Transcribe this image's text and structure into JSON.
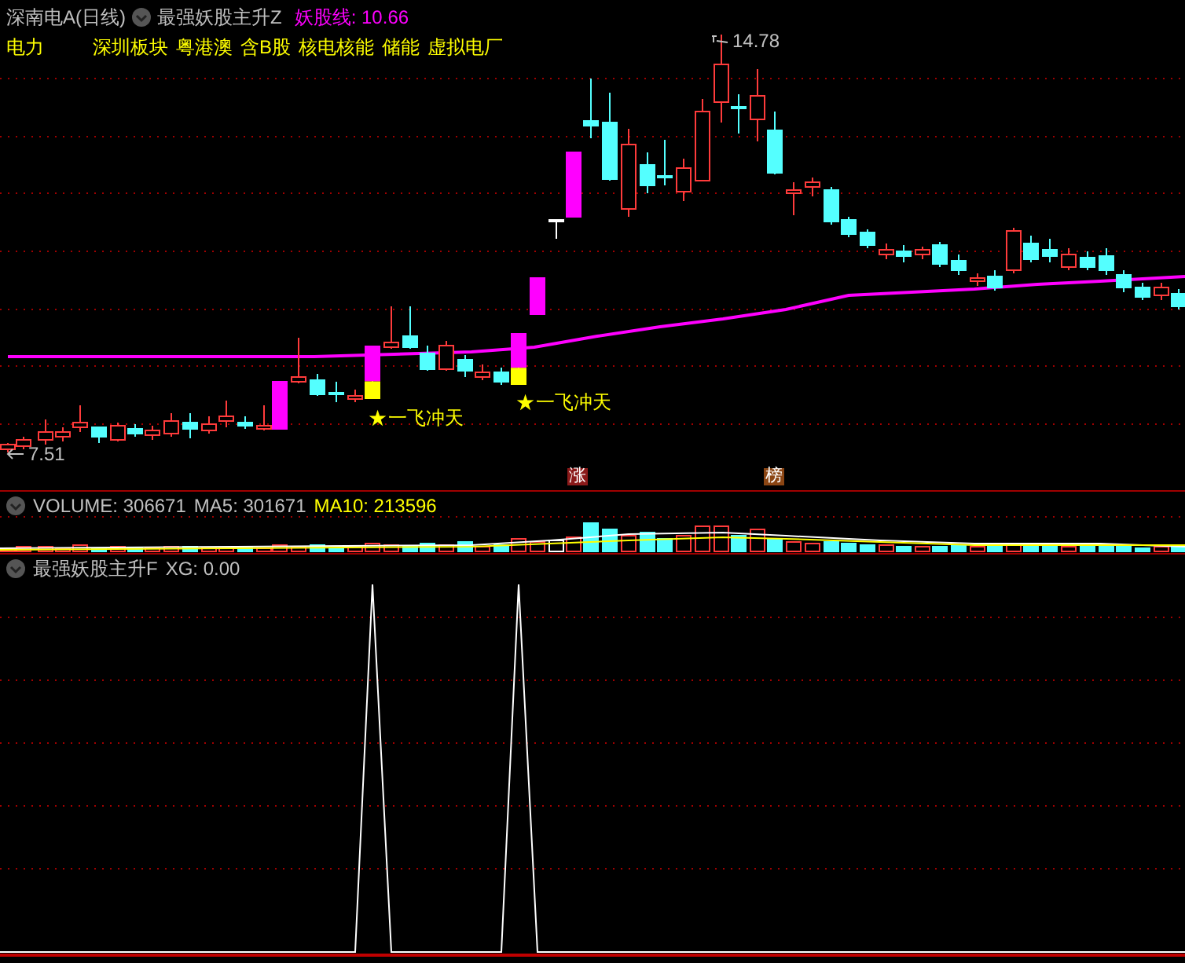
{
  "header": {
    "stock": "深南电A(日线)",
    "indicator": "最强妖股主升Z",
    "line_label": "妖股线: 10.66"
  },
  "tags": [
    "电力",
    "深圳板块",
    "粤港澳",
    "含B股",
    "核电核能",
    "储能",
    "虚拟电厂"
  ],
  "price_labels": {
    "high": "14.78",
    "low": "7.51"
  },
  "signals": [
    {
      "star": "★",
      "text": "一飞冲天"
    },
    {
      "star": "★",
      "text": "一飞冲天"
    }
  ],
  "badges": [
    {
      "text": "涨",
      "color": "#8b1a1a"
    },
    {
      "text": "榜",
      "color": "#8b4513"
    }
  ],
  "volume": {
    "volume": "VOLUME: 306671",
    "ma5": "MA5: 301671",
    "ma10": "MA10: 213596"
  },
  "sub_indicator": {
    "title": "最强妖股主升F",
    "value": "XG: 0.00"
  }
}
